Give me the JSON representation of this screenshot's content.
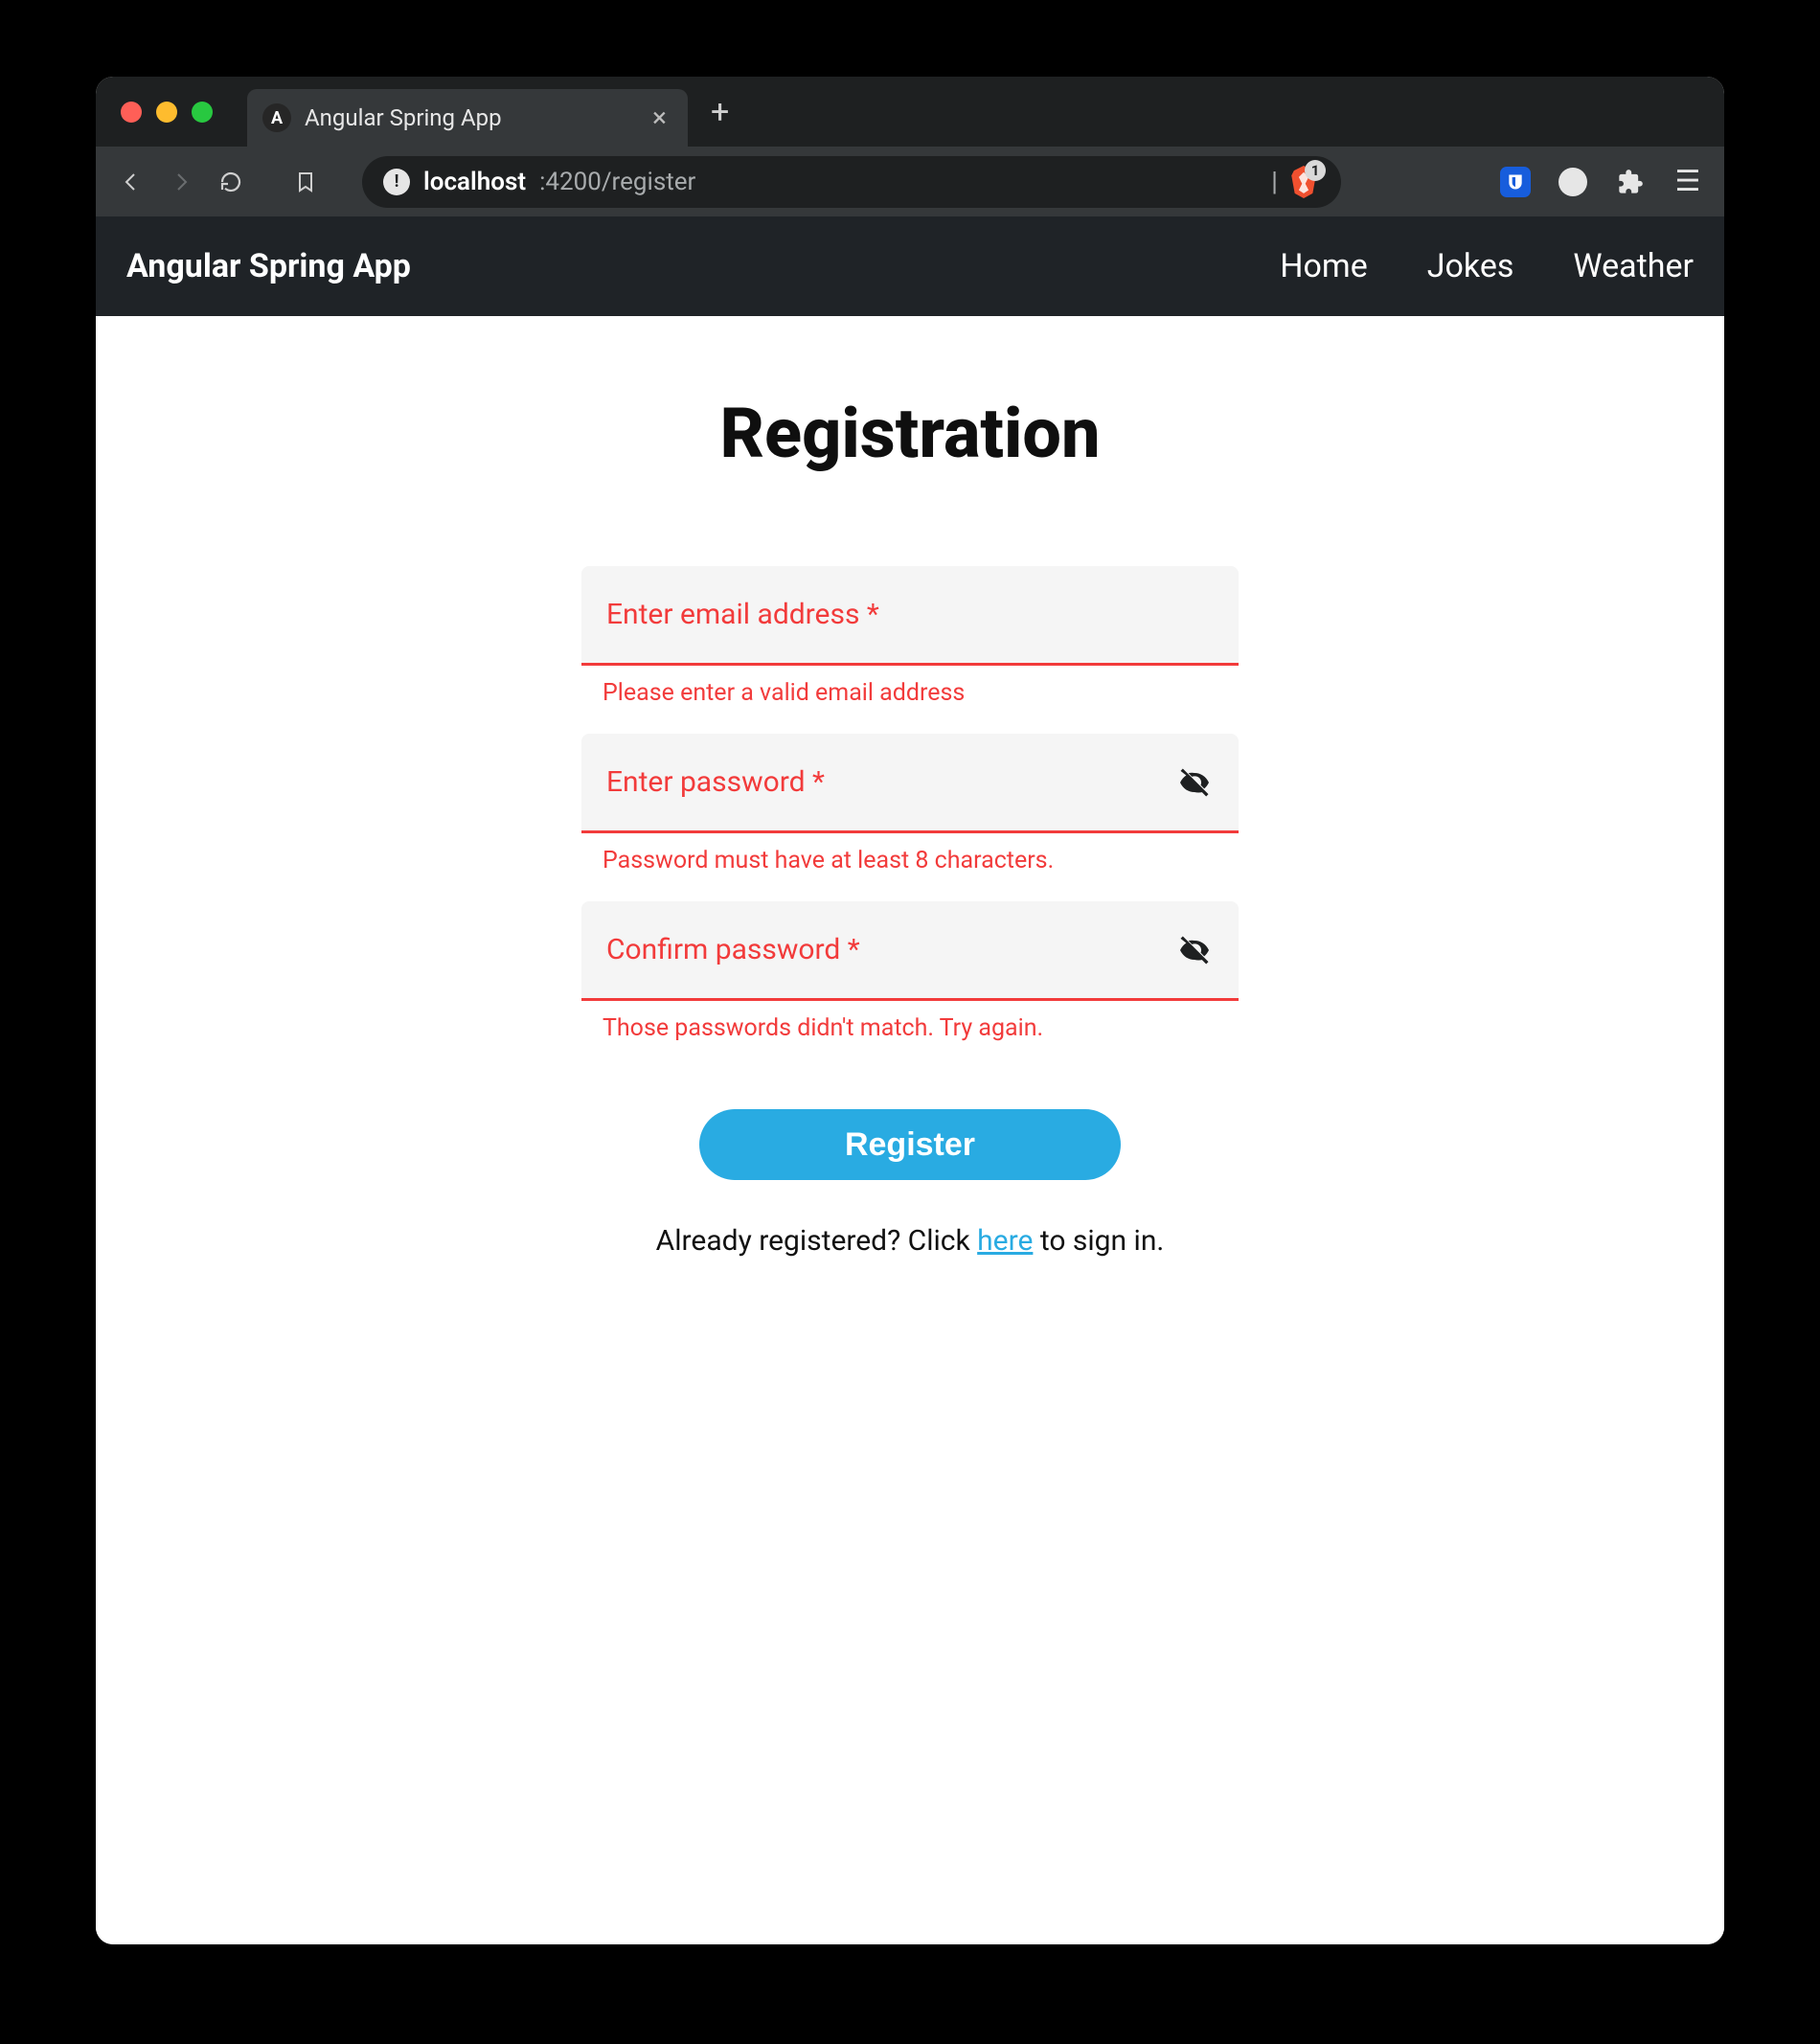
{
  "browser": {
    "tab_title": "Angular Spring App",
    "url_host": "localhost",
    "url_path": ":4200/register",
    "brave_count": "1"
  },
  "nav": {
    "brand": "Angular Spring App",
    "links": [
      "Home",
      "Jokes",
      "Weather"
    ]
  },
  "page": {
    "title": "Registration",
    "fields": {
      "email": {
        "label": "Enter email address *",
        "error": "Please enter a valid email address"
      },
      "password": {
        "label": "Enter password *",
        "error": "Password must have at least 8 characters."
      },
      "confirm": {
        "label": "Confirm password *",
        "error": "Those passwords didn't match. Try again."
      }
    },
    "submit_label": "Register",
    "signin_prefix": "Already registered? Click ",
    "signin_link": "here",
    "signin_suffix": " to sign in."
  }
}
